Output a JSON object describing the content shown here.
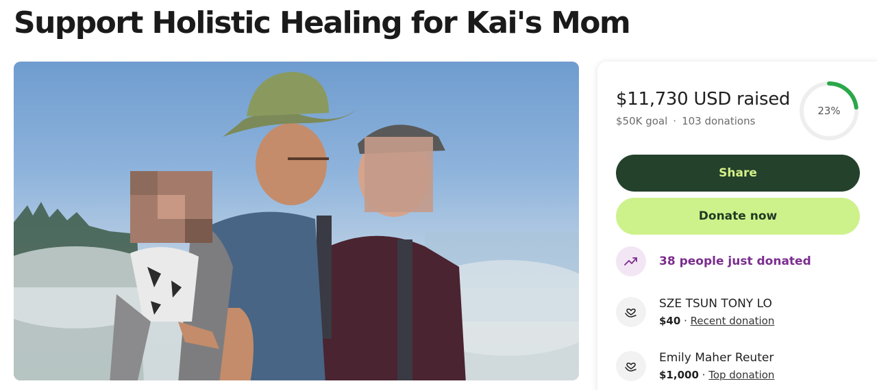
{
  "page": {
    "title": "Support Holistic Healing for Kai's Mom"
  },
  "photo": {
    "description_alt": "Fundraiser cover photo"
  },
  "summary": {
    "raised": "$11,730 USD raised",
    "goal": "$50K goal",
    "separator": "·",
    "donations": "103 donations",
    "percent_label": "23%",
    "percent_value": 0.23,
    "ring_color": "#2aa84a",
    "ring_track_color": "#eeeeee"
  },
  "actions": {
    "share_label": "Share",
    "donate_label": "Donate now",
    "share_bg": "#24412b",
    "donate_bg": "#cdf28c"
  },
  "activity": {
    "icon": "trending-up-icon",
    "text": "38 people just donated",
    "color": "#7b2d8e"
  },
  "donors": [
    {
      "name": "SZE TSUN TONY LO",
      "amount": "$40",
      "sep": " · ",
      "type": "Recent donation",
      "icon": "heart-hand-icon"
    },
    {
      "name": "Emily Maher Reuter",
      "amount": "$1,000",
      "sep": " · ",
      "type": "Top donation",
      "icon": "heart-hand-icon"
    }
  ]
}
